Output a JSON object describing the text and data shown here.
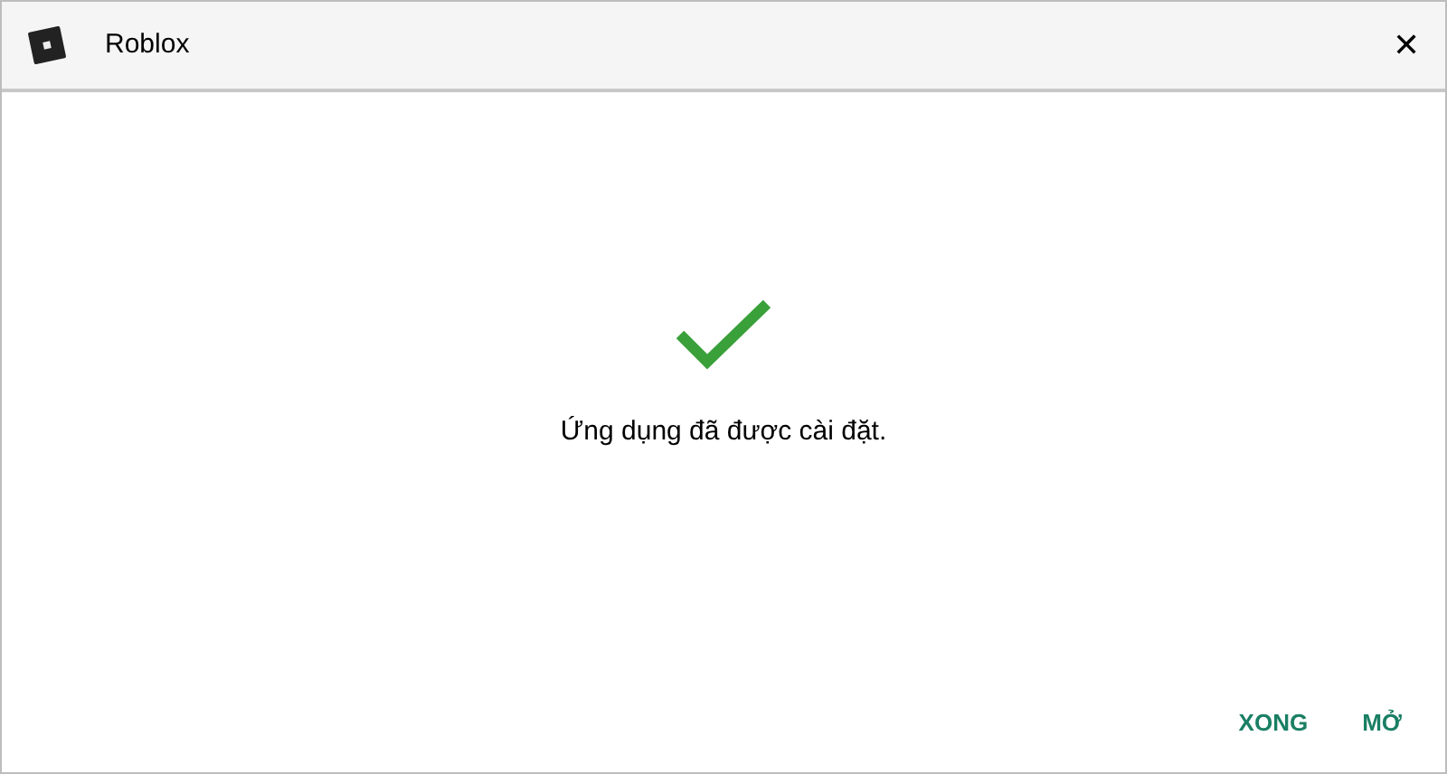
{
  "window": {
    "title": "Roblox",
    "close": "✕"
  },
  "message": "Ứng dụng đã được cài đặt.",
  "buttons": [
    "XONG",
    "MỞ"
  ]
}
